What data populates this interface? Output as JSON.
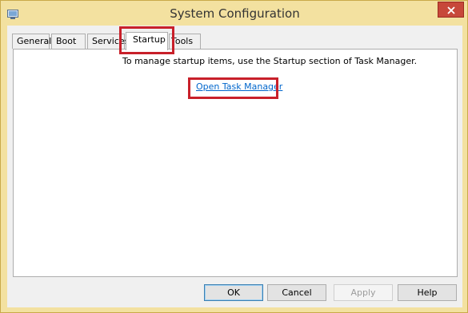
{
  "window": {
    "title": "System Configuration"
  },
  "titlebar": {
    "icon": "system-config-icon",
    "close_icon": "close-icon"
  },
  "tabs": [
    {
      "label": "General",
      "active": false
    },
    {
      "label": "Boot",
      "active": false
    },
    {
      "label": "Services",
      "active": false
    },
    {
      "label": "Startup",
      "active": true
    },
    {
      "label": "Tools",
      "active": false
    }
  ],
  "startup_panel": {
    "message": "To manage startup items, use the Startup section of Task Manager.",
    "link_label": "Open Task Manager"
  },
  "buttons": {
    "ok": "OK",
    "cancel": "Cancel",
    "apply": "Apply",
    "help": "Help"
  },
  "colors": {
    "titlebar": "#f3e1a0",
    "close_button": "#c7483a",
    "highlight": "#c8202a",
    "link": "#0066cc"
  }
}
